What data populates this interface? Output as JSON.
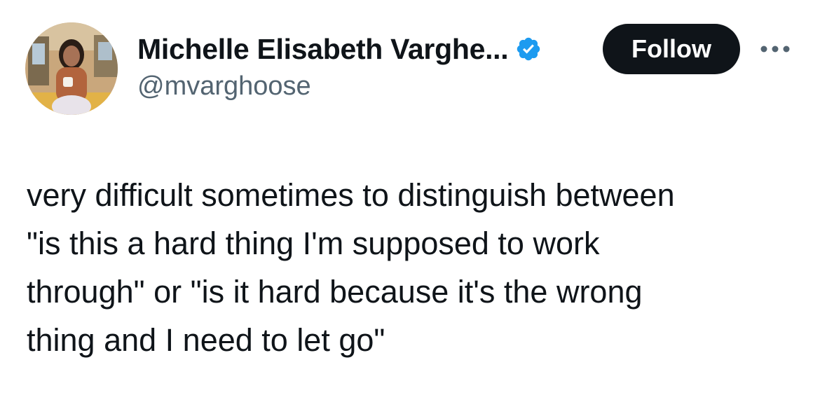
{
  "author": {
    "display_name": "Michelle Elisabeth Varghe...",
    "handle": "@mvarghoose",
    "verified": true,
    "verified_color": "#1d9bf0"
  },
  "actions": {
    "follow_label": "Follow",
    "more_icon": "more-horizontal-icon"
  },
  "tweet": {
    "lines": [
      "very difficult sometimes to distinguish between",
      "\"is this a hard thing I'm supposed to work",
      "through\" or \"is it hard because it's the wrong",
      "thing and I need to let go\""
    ]
  },
  "colors": {
    "text_primary": "#0f1419",
    "text_secondary": "#536471",
    "button_bg": "#0f1419",
    "button_text": "#ffffff"
  }
}
